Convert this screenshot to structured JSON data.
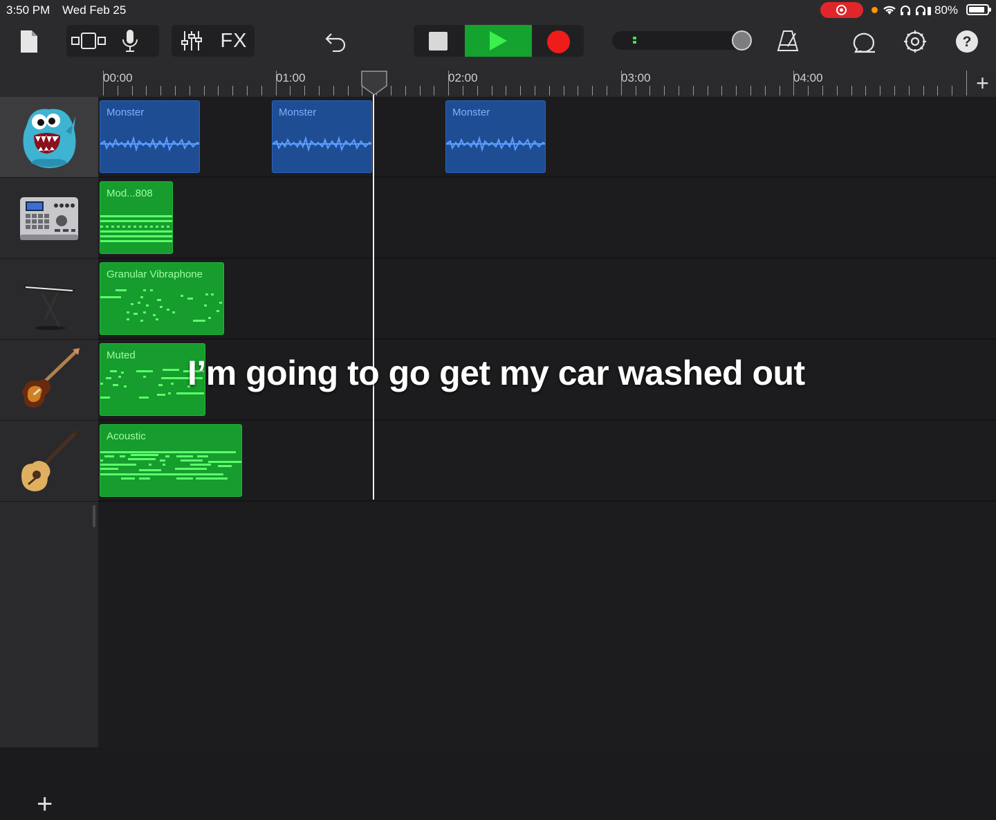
{
  "status_bar": {
    "time": "3:50 PM",
    "date": "Wed Feb 25",
    "battery": "80%"
  },
  "toolbar": {
    "fx_label": "FX",
    "icons": [
      "my-songs-icon",
      "browser-icon",
      "microphone-icon",
      "mixer-icon",
      "fx-icon",
      "undo-icon",
      "stop-icon",
      "play-icon",
      "record-icon",
      "metronome-icon",
      "loop-browser-icon",
      "settings-icon",
      "help-icon"
    ],
    "accent_play": "#15a32f",
    "accent_record": "#ef1c1c"
  },
  "ruler": {
    "labels": [
      "00:00",
      "01:00",
      "02:00",
      "03:00",
      "04:00"
    ]
  },
  "tracks": [
    {
      "instrument": "monster-vocal-icon",
      "regions": [
        {
          "label": "Monster"
        },
        {
          "label": "Monster"
        },
        {
          "label": "Monster"
        }
      ]
    },
    {
      "instrument": "drum-machine-icon",
      "regions": [
        {
          "label": "Mod...808"
        }
      ]
    },
    {
      "instrument": "keyboard-icon",
      "regions": [
        {
          "label": "Granular Vibraphone"
        }
      ]
    },
    {
      "instrument": "electric-guitar-icon",
      "regions": [
        {
          "label": "Muted"
        }
      ]
    },
    {
      "instrument": "acoustic-guitar-icon",
      "regions": [
        {
          "label": "Acoustic"
        }
      ]
    }
  ],
  "caption": "I’m going to go get my car washed out",
  "colors": {
    "audio_region": "#1e4d93",
    "midi_region": "#169d2d",
    "background": "#1c1c1e"
  }
}
